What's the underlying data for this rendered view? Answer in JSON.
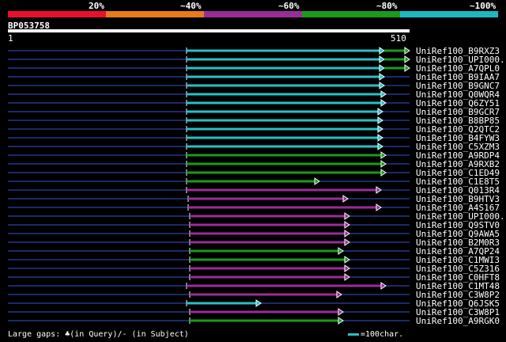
{
  "legend": {
    "segments": [
      {
        "color": "#e8102c"
      },
      {
        "color": "#e87a1c"
      },
      {
        "color": "#9a2c9a"
      },
      {
        "color": "#1c9a1c"
      },
      {
        "color": "#1cb8c0"
      }
    ],
    "labels": [
      "20%",
      "~40%",
      "~60%",
      "~80%",
      "~100%"
    ]
  },
  "query": {
    "id": "BP053758",
    "start": "1",
    "end": "510"
  },
  "hits": [
    {
      "name": "UniRef100_B9RXZ3",
      "color": "#26c0c8",
      "q_start": 236,
      "q_end": 486,
      "ext_color": "#1c9a1c",
      "ext_end": 518
    },
    {
      "name": "UniRef100_UPI000...",
      "color": "#26c0c8",
      "q_start": 236,
      "q_end": 486,
      "ext_color": "#1c9a1c",
      "ext_end": 518
    },
    {
      "name": "UniRef100_A7QPL0",
      "color": "#26c0c8",
      "q_start": 236,
      "q_end": 486,
      "ext_color": "#1c9a1c",
      "ext_end": 518
    },
    {
      "name": "UniRef100_B9IAA7",
      "color": "#26c0c8",
      "q_start": 236,
      "q_end": 486
    },
    {
      "name": "UniRef100_B9GNC7",
      "color": "#26c0c8",
      "q_start": 236,
      "q_end": 486
    },
    {
      "name": "UniRef100_Q0WQR4",
      "color": "#26c0c8",
      "q_start": 236,
      "q_end": 488
    },
    {
      "name": "UniRef100_Q6ZY51",
      "color": "#26c0c8",
      "q_start": 236,
      "q_end": 488
    },
    {
      "name": "UniRef100_B9GCR7",
      "color": "#26c0c8",
      "q_start": 236,
      "q_end": 484
    },
    {
      "name": "UniRef100_B8BP85",
      "color": "#26c0c8",
      "q_start": 236,
      "q_end": 484
    },
    {
      "name": "UniRef100_Q2QTC2",
      "color": "#26c0c8",
      "q_start": 236,
      "q_end": 484
    },
    {
      "name": "UniRef100_B4FYW3",
      "color": "#26c0c8",
      "q_start": 236,
      "q_end": 484
    },
    {
      "name": "UniRef100_C5XZM3",
      "color": "#26c0c8",
      "q_start": 236,
      "q_end": 484
    },
    {
      "name": "UniRef100_A9RDP4",
      "color": "#1c9a1c",
      "q_start": 236,
      "q_end": 488
    },
    {
      "name": "UniRef100_A9RXB2",
      "color": "#1c9a1c",
      "q_start": 236,
      "q_end": 488
    },
    {
      "name": "UniRef100_C1ED49",
      "color": "#1c9a1c",
      "q_start": 236,
      "q_end": 488
    },
    {
      "name": "UniRef100_C1E8T5",
      "color": "#1c9a1c",
      "q_start": 236,
      "q_end": 404
    },
    {
      "name": "UniRef100_Q013R4",
      "color": "#9a2c9a",
      "q_start": 236,
      "q_end": 482
    },
    {
      "name": "UniRef100_B9HTV3",
      "color": "#9a2c9a",
      "q_start": 238,
      "q_end": 440
    },
    {
      "name": "UniRef100_A4S167",
      "color": "#9a2c9a",
      "q_start": 238,
      "q_end": 482
    },
    {
      "name": "UniRef100_UPI000...",
      "color": "#9a2c9a",
      "q_start": 240,
      "q_end": 442
    },
    {
      "name": "UniRef100_Q9STV0",
      "color": "#9a2c9a",
      "q_start": 240,
      "q_end": 442
    },
    {
      "name": "UniRef100_Q9AWA5",
      "color": "#9a2c9a",
      "q_start": 240,
      "q_end": 442
    },
    {
      "name": "UniRef100_B2M0R3",
      "color": "#9a2c9a",
      "q_start": 240,
      "q_end": 442
    },
    {
      "name": "UniRef100_A7QP24",
      "color": "#1c9a1c",
      "q_start": 240,
      "q_end": 434
    },
    {
      "name": "UniRef100_C1MWI3",
      "color": "#1c9a1c",
      "q_start": 240,
      "q_end": 442
    },
    {
      "name": "UniRef100_C5Z316",
      "color": "#9a2c9a",
      "q_start": 240,
      "q_end": 442
    },
    {
      "name": "UniRef100_C0HFT8",
      "color": "#9a2c9a",
      "q_start": 240,
      "q_end": 442
    },
    {
      "name": "UniRef100_C1MT48",
      "color": "#9a2c9a",
      "q_start": 236,
      "q_end": 488
    },
    {
      "name": "UniRef100_C3W8P2",
      "color": "#9a2c9a",
      "q_start": 240,
      "q_end": 432
    },
    {
      "name": "UniRef100_Q6JSK5",
      "color": "#26c0c8",
      "q_start": 236,
      "q_end": 330
    },
    {
      "name": "UniRef100_C3W8P1",
      "color": "#9a2c9a",
      "q_start": 240,
      "q_end": 434
    },
    {
      "name": "UniRef100_A9RGK0",
      "color": "#1c9a1c",
      "q_start": 240,
      "q_end": 434
    }
  ],
  "footer": {
    "text": "Large gaps: ♣(in Query)/- (in Subject)",
    "scale_text": "=100char."
  }
}
